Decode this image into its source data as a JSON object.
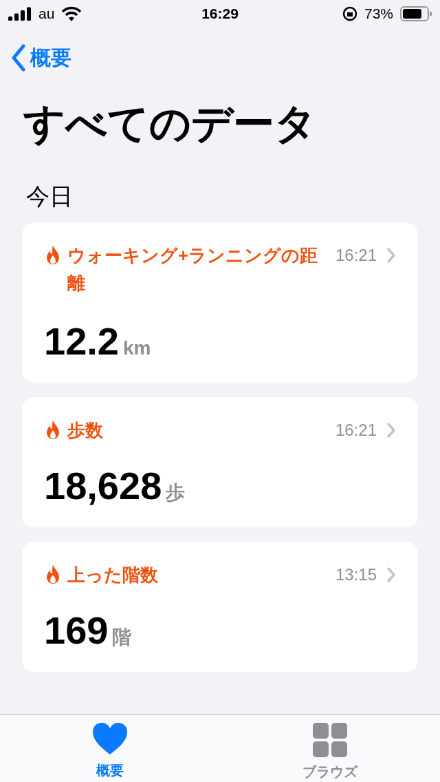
{
  "status_bar": {
    "carrier": "au",
    "time": "16:29",
    "battery": "73%"
  },
  "nav": {
    "back_label": "概要"
  },
  "title": "すべてのデータ",
  "section": "今日",
  "cards": [
    {
      "title": "ウォーキング+ランニングの距離",
      "time": "16:21",
      "value": "12.2",
      "unit": "km"
    },
    {
      "title": "歩数",
      "time": "16:21",
      "value": "18,628",
      "unit": "歩"
    },
    {
      "title": "上った階数",
      "time": "13:15",
      "value": "169",
      "unit": "階"
    }
  ],
  "tab_bar": [
    {
      "label": "概要",
      "selected": true,
      "kind": "heart"
    },
    {
      "label": "ブラウズ",
      "selected": false,
      "kind": "grid"
    }
  ]
}
